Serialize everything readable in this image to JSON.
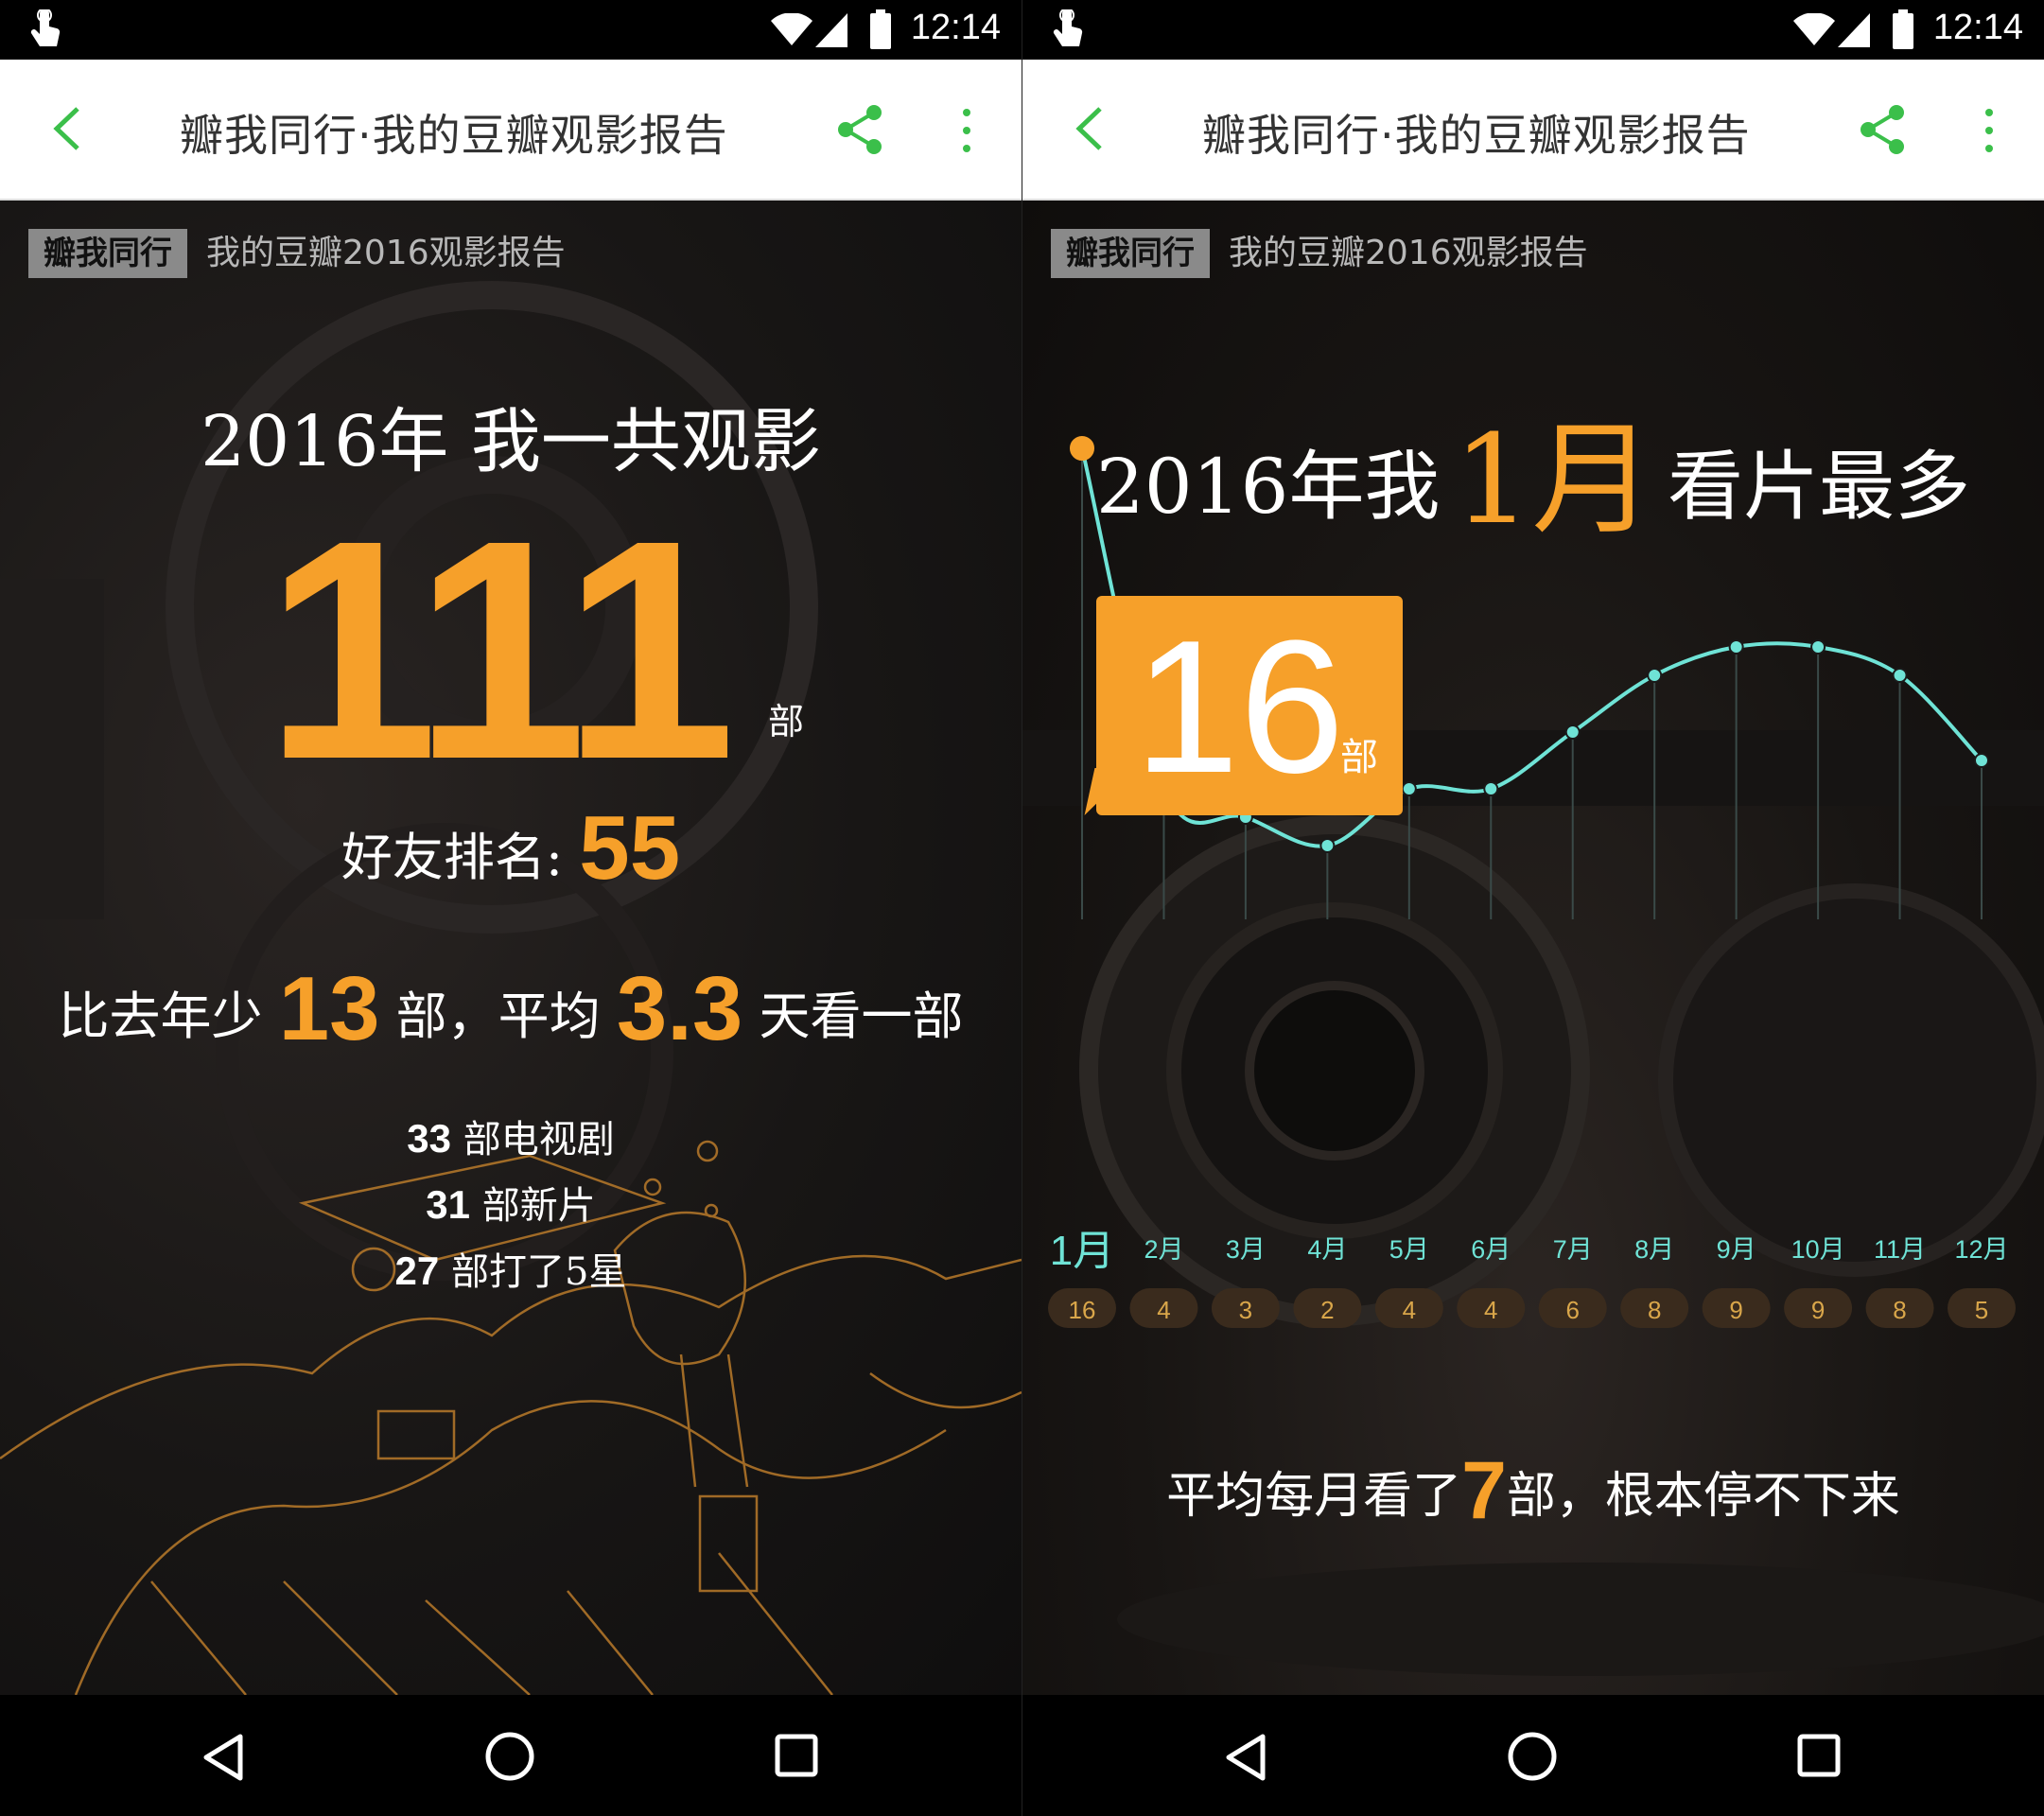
{
  "status": {
    "time": "12:14"
  },
  "toolbar": {
    "title": "瓣我同行·我的豆瓣观影报告"
  },
  "banner": {
    "tag": "瓣我同行",
    "subtitle": "我的豆瓣2016观影报告"
  },
  "summary": {
    "heading": "2016年 我一共观影",
    "total": "111",
    "unit": "部",
    "rank_label": "好友排名:",
    "rank_value": "55",
    "compare_prefix": "比去年少",
    "compare_value": "13",
    "compare_mid": "部，平均",
    "avg_value": "3.3",
    "compare_suffix": "天看一部",
    "stats": [
      {
        "value": "33",
        "label": "部电视剧"
      },
      {
        "value": "31",
        "label": "部新片"
      },
      {
        "value": "27",
        "label": "部打了5星"
      }
    ]
  },
  "monthly": {
    "heading_prefix": "2016年我",
    "heading_month": "1月",
    "heading_suffix": "看片最多",
    "peak_value": "16",
    "peak_unit": "部",
    "footer_prefix": "平均每月看了",
    "footer_value": "7",
    "footer_suffix": "部，根本停不下来"
  },
  "chart_data": {
    "type": "line",
    "categories": [
      "1月",
      "2月",
      "3月",
      "4月",
      "5月",
      "6月",
      "7月",
      "8月",
      "9月",
      "10月",
      "11月",
      "12月"
    ],
    "values": [
      16,
      4,
      3,
      2,
      4,
      4,
      6,
      8,
      9,
      9,
      8,
      5
    ],
    "highlight_index": 0,
    "colors": {
      "line": "#6fe3d6",
      "accent": "#f6a02a",
      "label": "#d9a64a",
      "pill": "#3a2b1d"
    }
  }
}
